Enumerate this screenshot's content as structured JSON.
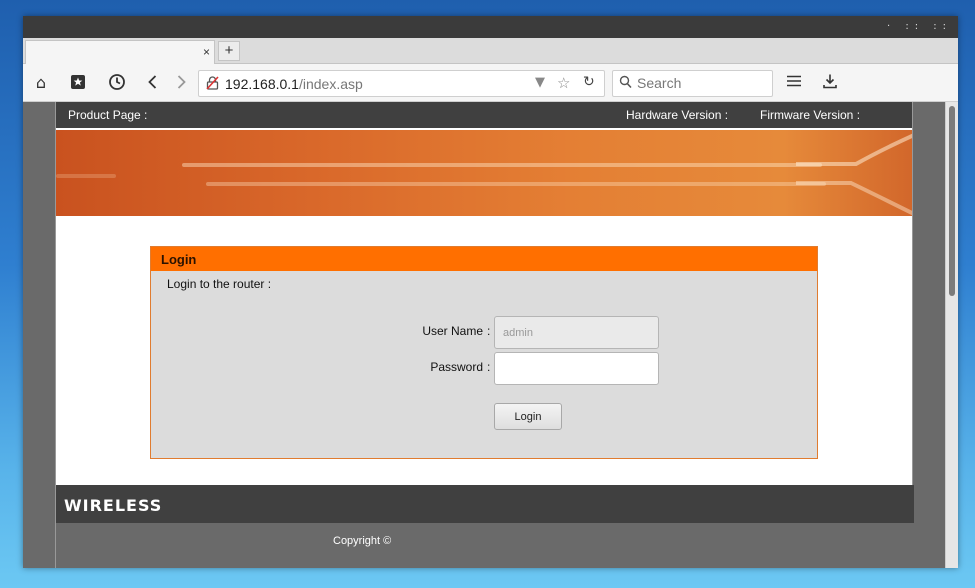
{
  "browser": {
    "titlebar_dots": "· :: ::",
    "tab": {
      "title": "",
      "close": "×"
    },
    "new_tab": "+",
    "url": {
      "host": "192.168.0.1",
      "path": "/index.asp"
    },
    "search": {
      "placeholder": "Search"
    },
    "icons": [
      "home-icon",
      "bookmarks-icon",
      "history-icon",
      "back-icon",
      "forward-icon",
      "insecure-lock-icon",
      "dropdown-icon",
      "star-icon",
      "reload-icon",
      "search-icon",
      "menu-icon",
      "download-icon"
    ]
  },
  "router": {
    "top": {
      "product_page": "Product Page :",
      "hardware_version": "Hardware Version :",
      "firmware_version": "Firmware Version :"
    },
    "login": {
      "heading": "Login",
      "subtitle": "Login to the router :",
      "username_label": "User Name",
      "username_value": "admin",
      "password_label": "Password",
      "password_value": "",
      "colon": ":",
      "button": "Login"
    },
    "footer": {
      "brand": "WIRELESS",
      "copyright": "Copyright ©"
    }
  },
  "colors": {
    "accent_orange": "#ff6f00",
    "dark_bar": "#404040"
  }
}
